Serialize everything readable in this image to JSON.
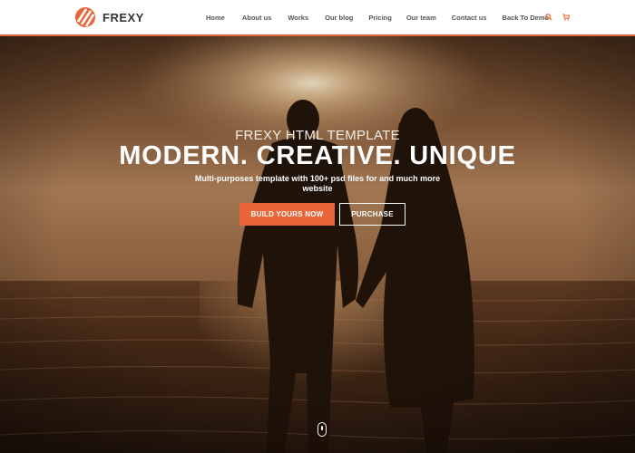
{
  "brand": {
    "name": "FREXY",
    "accent": "#e8663a"
  },
  "nav": {
    "items": [
      {
        "label": "Home"
      },
      {
        "label": "About us"
      },
      {
        "label": "Works"
      },
      {
        "label": "Our blog"
      },
      {
        "label": "Pricing"
      },
      {
        "label": "Our team"
      },
      {
        "label": "Contact us"
      },
      {
        "label": "Back To Demo"
      }
    ],
    "icons": [
      "search-icon",
      "cart-icon"
    ]
  },
  "hero": {
    "eyebrow": "FREXY HTML TEMPLATE",
    "headline": "MODERN. CREATIVE. UNIQUE",
    "subline": "Multi-purposes template with 100+ psd files for and much more website",
    "primary_button": "BUILD YOURS NOW",
    "secondary_button": "PURCHASE",
    "scroll_icon": "mouse-scroll-icon"
  }
}
